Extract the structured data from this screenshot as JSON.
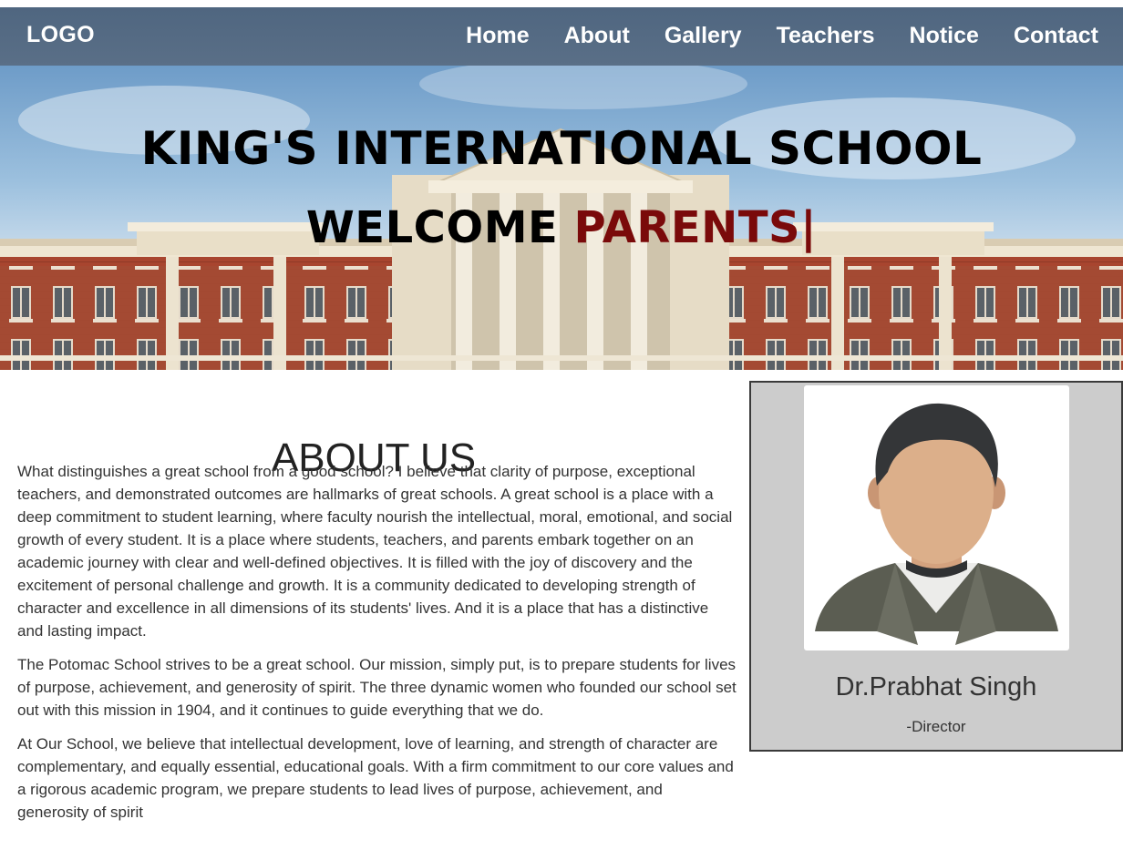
{
  "navbar": {
    "logo": "LOGO",
    "links": [
      "Home",
      "About",
      "Gallery",
      "Teachers",
      "Notice",
      "Contact"
    ]
  },
  "hero": {
    "title": "KING'S INTERNATIONAL SCHOOL",
    "welcome_prefix": "WELCOME ",
    "welcome_highlight": "PARENTS|",
    "accent_color": "#7a0a0a"
  },
  "about": {
    "title": "ABOUT US",
    "paragraphs": [
      "What distinguishes a great school from a good school? I believe that clarity of purpose, exceptional teachers, and demonstrated outcomes are hallmarks of great schools. A great school is a place with a deep commitment to student learning, where faculty nourish the intellectual, moral, emotional, and social growth of every student. It is a place where students, teachers, and parents embark together on an academic journey with clear and well-defined objectives. It is filled with the joy of discovery and the excitement of personal challenge and growth. It is a community dedicated to developing strength of character and excellence in all dimensions of its students' lives. And it is a place that has a distinctive and lasting impact.",
      "The Potomac School strives to be a great school. Our mission, simply put, is to prepare students for lives of purpose, achievement, and generosity of spirit. The three dynamic women who founded our school set out with this mission in 1904, and it continues to guide everything that we do.",
      "At Our School, we believe that intellectual development, love of learning, and strength of character are complementary, and equally essential, educational goals. With a firm commitment to our core values and a rigorous academic program, we prepare students to lead lives of purpose, achievement, and generosity of spirit"
    ]
  },
  "profile": {
    "name": "Dr.Prabhat Singh",
    "role": "-Director",
    "avatar_icon": "person-avatar-icon"
  }
}
